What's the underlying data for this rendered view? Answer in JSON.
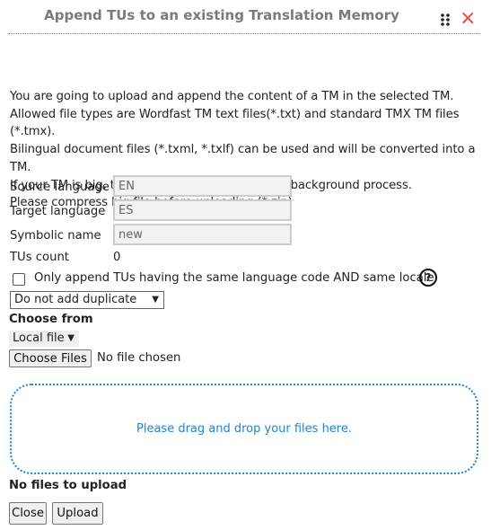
{
  "dialog": {
    "title": "Append TUs to an existing Translation Memory",
    "close_icon": "×"
  },
  "intro": [
    "You are going to upload and append the content of a TM in the selected TM.",
    "Allowed file types are Wordfast TM text files(*.txt) and standard TMX TM files (*.tmx).",
    "Bilingual document files (*.txml, *.txlf) can be used and will be converted into a TM.",
    "If your TM is big, the upload will be queued in a background process.",
    "Please compress big file before uploading (*.zip)"
  ],
  "fields": {
    "source_label": "Source language",
    "source_value": "EN",
    "target_label": "Target language",
    "target_value": "ES",
    "symbolic_label": "Symbolic name",
    "symbolic_value": "new",
    "count_label": "TUs count",
    "count_value": "0"
  },
  "locale_checkbox": {
    "label": "Only append TUs having the same language code AND same locale.",
    "checked": false,
    "help": "?"
  },
  "duplicate_select": {
    "value": "Do not add duplicate"
  },
  "choose_from": {
    "label": "Choose from",
    "value": "Local file"
  },
  "file_input": {
    "button": "Choose Files",
    "status": "No file chosen"
  },
  "dropzone": {
    "text": "Please drag and drop your files here."
  },
  "upload_status": "No files to upload",
  "buttons": {
    "close": "Close",
    "upload": "Upload"
  },
  "colors": {
    "accent": "#1d84cf",
    "close": "#e8433a"
  }
}
